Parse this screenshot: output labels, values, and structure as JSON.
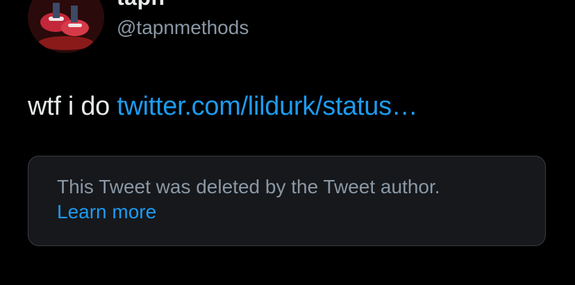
{
  "tweet": {
    "author": {
      "display_name": "tapn",
      "handle": "@tapnmethods",
      "avatar_icon": "profile-avatar"
    },
    "more_icon": "more-horizontal-icon",
    "text_prefix": "wtf i do ",
    "link_text": "twitter.com/lildurk/status…",
    "quoted": {
      "message": "This Tweet was deleted by the Tweet author.",
      "learn_more": "Learn more"
    }
  },
  "colors": {
    "background": "#000000",
    "primary_text": "#e7e9ea",
    "secondary_text": "#8b98a5",
    "link": "#1d9bf0",
    "card_background": "#16181c",
    "card_border": "#3a3d42"
  }
}
